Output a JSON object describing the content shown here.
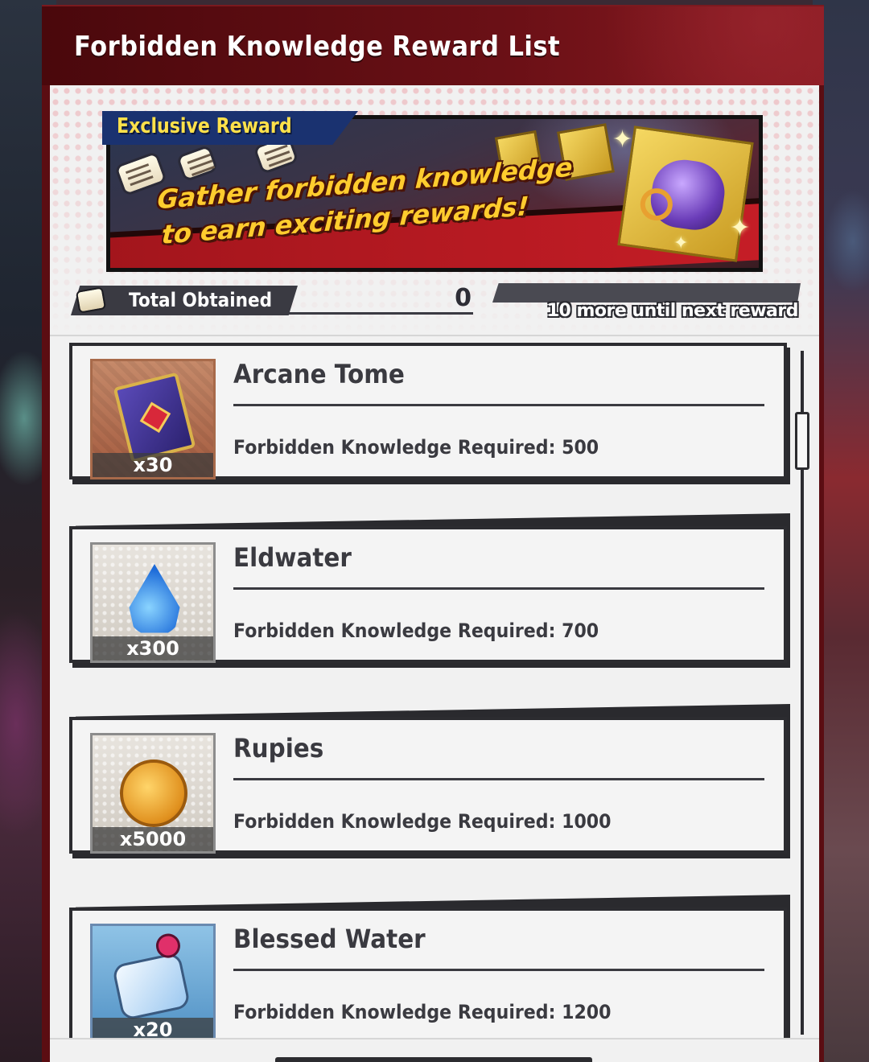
{
  "dialog": {
    "title": "Forbidden Knowledge Reward List"
  },
  "banner": {
    "tag": "Exclusive Reward",
    "headline_line1": "Gather forbidden knowledge",
    "headline_line2": "to earn exciting rewards!"
  },
  "totals": {
    "label": "Total Obtained",
    "value": "0",
    "progress_text": "10 more until next reward",
    "progress_fraction": 0
  },
  "rewards": [
    {
      "name": "Arcane Tome",
      "quantity": "x30",
      "requirement": "Forbidden Knowledge Required: 500",
      "icon": "arcane-tome-icon",
      "frame": "bronze"
    },
    {
      "name": "Eldwater",
      "quantity": "x300",
      "requirement": "Forbidden Knowledge Required: 700",
      "icon": "eldwater-drop-icon",
      "frame": "silver"
    },
    {
      "name": "Rupies",
      "quantity": "x5000",
      "requirement": "Forbidden Knowledge Required: 1000",
      "icon": "rupies-coin-icon",
      "frame": "silver"
    },
    {
      "name": "Blessed Water",
      "quantity": "x20",
      "requirement": "Forbidden Knowledge Required: 1200",
      "icon": "blessed-water-bottle-icon",
      "frame": "blue"
    }
  ],
  "colors": {
    "header": "#5b0d12",
    "panel_body": "#f1f1f1",
    "accent_gold": "#ffcc2e",
    "tag_blue": "#1a3270",
    "dark_ink": "#3a3a40"
  }
}
